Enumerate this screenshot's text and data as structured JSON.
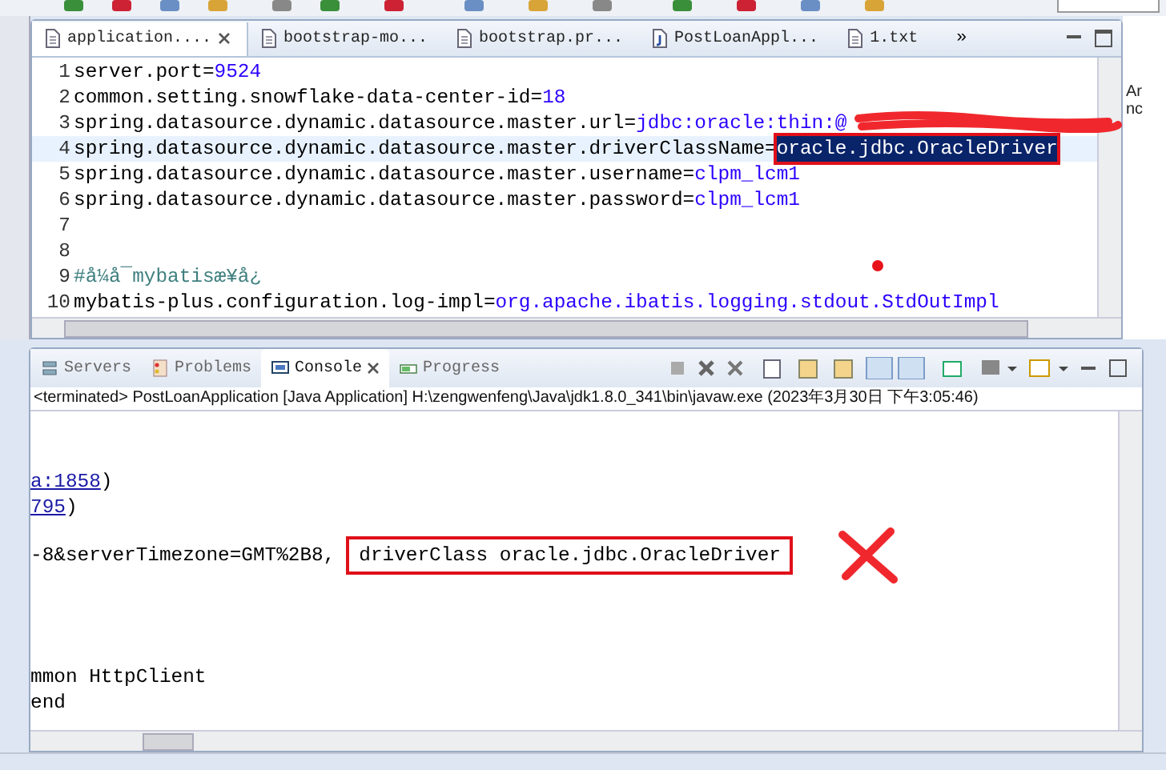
{
  "editor": {
    "tabs": [
      {
        "label": "application....",
        "selected": true,
        "kind": "properties"
      },
      {
        "label": "bootstrap-mo...",
        "selected": false,
        "kind": "properties"
      },
      {
        "label": "bootstrap.pr...",
        "selected": false,
        "kind": "properties"
      },
      {
        "label": "PostLoanAppl...",
        "selected": false,
        "kind": "java"
      },
      {
        "label": "1.txt",
        "selected": false,
        "kind": "text"
      }
    ],
    "overflow": "»",
    "lines": [
      {
        "number": "1",
        "kind": "property",
        "key": "server.port=",
        "value": "9524",
        "current": false,
        "selected_value": false,
        "redacted": false
      },
      {
        "number": "2",
        "kind": "property",
        "key": "common.setting.snowflake-data-center-id=",
        "value": "18",
        "current": false,
        "selected_value": false,
        "redacted": false
      },
      {
        "number": "3",
        "kind": "property",
        "key": "spring.datasource.dynamic.datasource.master.url=",
        "value": "jdbc:oracle:thin:@",
        "current": false,
        "selected_value": false,
        "redacted": true
      },
      {
        "number": "4",
        "kind": "property",
        "key": "spring.datasource.dynamic.datasource.master.driverClassName=",
        "value": "oracle.jdbc.OracleDriver",
        "current": true,
        "selected_value": true,
        "redacted": false
      },
      {
        "number": "5",
        "kind": "property",
        "key": "spring.datasource.dynamic.datasource.master.username=",
        "value": "clpm_lcm1",
        "current": false,
        "selected_value": false,
        "redacted": false
      },
      {
        "number": "6",
        "kind": "property",
        "key": "spring.datasource.dynamic.datasource.master.password=",
        "value": "clpm_lcm1",
        "current": false,
        "selected_value": false,
        "redacted": false
      },
      {
        "number": "7",
        "kind": "blank"
      },
      {
        "number": "8",
        "kind": "blank"
      },
      {
        "number": "9",
        "kind": "comment",
        "text": "#å¼å¯mybatisæ¥å¿"
      },
      {
        "number": "10",
        "kind": "property",
        "key": "mybatis-plus.configuration.log-impl=",
        "value": "org.apache.ibatis.logging.stdout.StdOutImpl",
        "current": false,
        "selected_value": false,
        "redacted": false
      }
    ]
  },
  "side_pane": {
    "lines": [
      "Ar",
      "nc"
    ]
  },
  "console": {
    "tabs": [
      {
        "label": "Servers",
        "selected": false,
        "kind": "servers"
      },
      {
        "label": "Problems",
        "selected": false,
        "kind": "problems"
      },
      {
        "label": "Console",
        "selected": true,
        "kind": "console"
      },
      {
        "label": "Progress",
        "selected": false,
        "kind": "progress"
      }
    ],
    "header": "<terminated> PostLoanApplication [Java Application] H:\\zengwenfeng\\Java\\jdk1.8.0_341\\bin\\javaw.exe (2023年3月30日 下午3:05:46)",
    "blocks": [
      [
        [
          {
            "text": "a:1858",
            "link": true,
            "boxed": false
          },
          {
            "text": ")",
            "link": false,
            "boxed": false
          }
        ],
        [
          {
            "text": "795",
            "link": true,
            "boxed": false
          },
          {
            "text": ")",
            "link": false,
            "boxed": false
          }
        ]
      ],
      [
        [
          {
            "text": "-8&serverTimezone=GMT%2B8,",
            "link": false,
            "boxed": false
          },
          {
            "text": "driverClass oracle.jdbc.OracleDriver",
            "link": false,
            "boxed": true
          }
        ]
      ],
      [
        [
          {
            "text": "mmon HttpClient",
            "link": false,
            "boxed": false
          }
        ],
        [
          {
            "text": "end",
            "link": false,
            "boxed": false
          }
        ]
      ]
    ]
  }
}
